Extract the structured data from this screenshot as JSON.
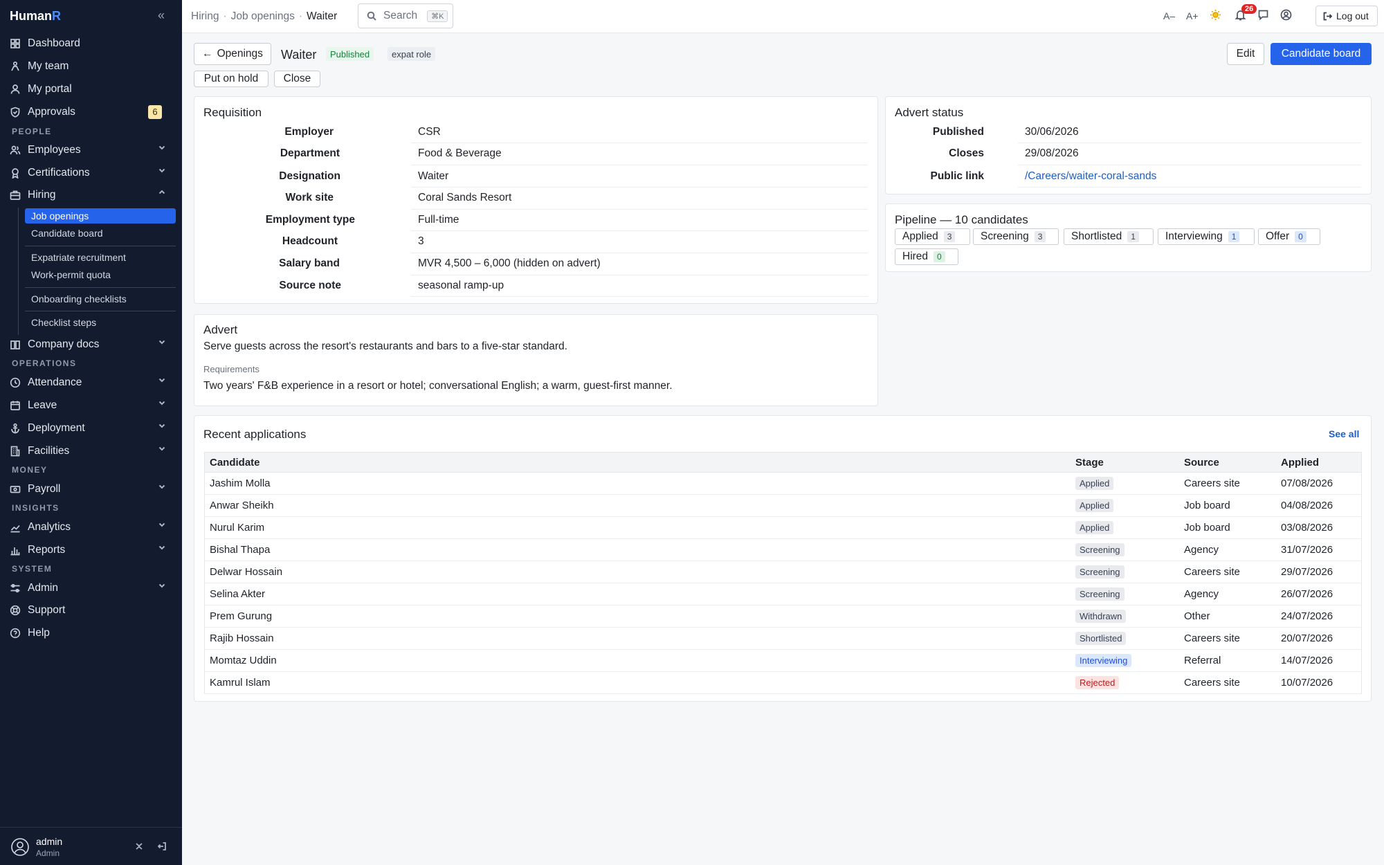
{
  "app": {
    "brand_main": "Human",
    "brand_accent": "R"
  },
  "sidebar": {
    "top_items": [
      {
        "label": "Dashboard",
        "icon": "grid-icon"
      },
      {
        "label": "My team",
        "icon": "team-icon"
      },
      {
        "label": "My portal",
        "icon": "person-icon"
      },
      {
        "label": "Approvals",
        "icon": "shield-check-icon",
        "badge": "6"
      }
    ],
    "sections": {
      "people": "PEOPLE",
      "operations": "OPERATIONS",
      "money": "MONEY",
      "insights": "INSIGHTS",
      "system": "SYSTEM"
    },
    "people_items": [
      {
        "label": "Employees"
      },
      {
        "label": "Certifications"
      },
      {
        "label": "Hiring"
      }
    ],
    "hiring_sub": [
      {
        "label": "Job openings",
        "active": true
      },
      {
        "label": "Candidate board"
      },
      {
        "label": "Expatriate recruitment"
      },
      {
        "label": "Work-permit quota"
      },
      {
        "label": "Onboarding checklists"
      },
      {
        "label": "Checklist steps"
      }
    ],
    "company_docs": "Company docs",
    "operations_items": [
      {
        "label": "Attendance"
      },
      {
        "label": "Leave"
      },
      {
        "label": "Deployment"
      },
      {
        "label": "Facilities"
      }
    ],
    "money_items": [
      {
        "label": "Payroll"
      }
    ],
    "insights_items": [
      {
        "label": "Analytics"
      },
      {
        "label": "Reports"
      }
    ],
    "system_items": [
      {
        "label": "Admin"
      },
      {
        "label": "Support"
      },
      {
        "label": "Help"
      }
    ],
    "user": {
      "name": "admin",
      "role": "Admin"
    }
  },
  "topbar": {
    "breadcrumb": [
      "Hiring",
      "Job openings",
      "Waiter"
    ],
    "search_placeholder": "Search",
    "search_kbd": "⌘K",
    "font_smaller": "A–",
    "font_larger": "A+",
    "notifications": "26",
    "logout": "Log out"
  },
  "header": {
    "back_label": "Openings",
    "title": "Waiter",
    "status": "Published",
    "tag": "expat role",
    "hold_label": "Put on hold",
    "close_label": "Close",
    "edit_label": "Edit",
    "board_label": "Candidate board"
  },
  "requisition": {
    "title": "Requisition",
    "rows": [
      {
        "label": "Employer",
        "value": "CSR"
      },
      {
        "label": "Department",
        "value": "Food & Beverage"
      },
      {
        "label": "Designation",
        "value": "Waiter"
      },
      {
        "label": "Work site",
        "value": "Coral Sands Resort"
      },
      {
        "label": "Employment type",
        "value": "Full-time"
      },
      {
        "label": "Headcount",
        "value": "3"
      },
      {
        "label": "Salary band",
        "value": "MVR 4,500 – 6,000 (hidden on advert)"
      },
      {
        "label": "Source note",
        "value": "seasonal ramp-up"
      }
    ]
  },
  "advert_status": {
    "title": "Advert status",
    "rows": [
      {
        "label": "Published",
        "value": "30/06/2026"
      },
      {
        "label": "Closes",
        "value": "29/08/2026"
      },
      {
        "label": "Public link",
        "value": "/Careers/waiter-coral-sands"
      }
    ]
  },
  "pipeline": {
    "title": "Pipeline — 10 candidates",
    "stages": [
      {
        "label": "Applied",
        "count": "3"
      },
      {
        "label": "Screening",
        "count": "3"
      },
      {
        "label": "Shortlisted",
        "count": "1"
      },
      {
        "label": "Interviewing",
        "count": "1"
      },
      {
        "label": "Offer",
        "count": "0"
      },
      {
        "label": "Hired",
        "count": "0"
      }
    ]
  },
  "advert": {
    "title": "Advert",
    "description": "Serve guests across the resort's restaurants and bars to a five-star standard.",
    "req_label": "Requirements",
    "requirements": "Two years' F&B experience in a resort or hotel; conversational English; a warm, guest-first manner."
  },
  "applications": {
    "title": "Recent applications",
    "see_all": "See all",
    "columns": [
      "Candidate",
      "Stage",
      "Source",
      "Applied"
    ],
    "rows": [
      {
        "candidate": "Jashim Molla",
        "stage": "Applied",
        "source": "Careers site",
        "applied": "07/08/2026"
      },
      {
        "candidate": "Anwar Sheikh",
        "stage": "Applied",
        "source": "Job board",
        "applied": "04/08/2026"
      },
      {
        "candidate": "Nurul Karim",
        "stage": "Applied",
        "source": "Job board",
        "applied": "03/08/2026"
      },
      {
        "candidate": "Bishal Thapa",
        "stage": "Screening",
        "source": "Agency",
        "applied": "31/07/2026"
      },
      {
        "candidate": "Delwar Hossain",
        "stage": "Screening",
        "source": "Careers site",
        "applied": "29/07/2026"
      },
      {
        "candidate": "Selina Akter",
        "stage": "Screening",
        "source": "Agency",
        "applied": "26/07/2026"
      },
      {
        "candidate": "Prem Gurung",
        "stage": "Withdrawn",
        "source": "Other",
        "applied": "24/07/2026"
      },
      {
        "candidate": "Rajib Hossain",
        "stage": "Shortlisted",
        "source": "Careers site",
        "applied": "20/07/2026"
      },
      {
        "candidate": "Momtaz Uddin",
        "stage": "Interviewing",
        "source": "Referral",
        "applied": "14/07/2026"
      },
      {
        "candidate": "Kamrul Islam",
        "stage": "Rejected",
        "source": "Careers site",
        "applied": "10/07/2026"
      }
    ]
  },
  "colors": {
    "accent": "#2563eb",
    "sidebar_bg": "#131c2e",
    "link": "#1d5fc4"
  }
}
